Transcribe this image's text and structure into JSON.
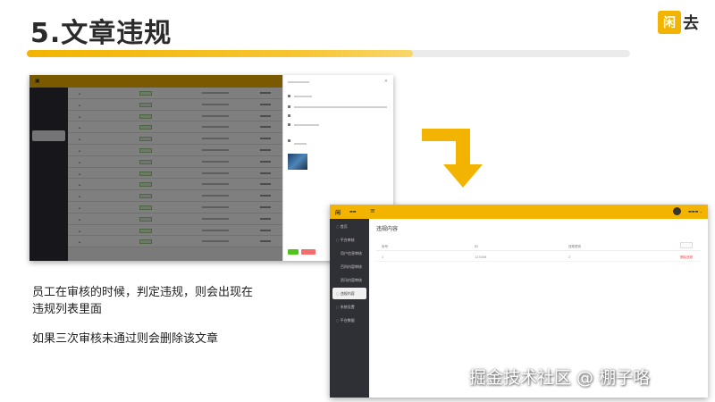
{
  "slide": {
    "title": "5.文章违规",
    "progress_fraction": 0.64
  },
  "logo": {
    "badge_char": "闲",
    "text": "去",
    "color": "#f2b400"
  },
  "caption": {
    "line1": "员工在审核的时候，判定违规，则会出现在",
    "line2": "违规列表里面",
    "line3": "如果三次审核未通过则会删除该文章"
  },
  "app": {
    "accent": "#f2b400",
    "sidebar_color": "#2f2f36",
    "title": "违规内容",
    "menu_icon": "hamburger-icon",
    "sidebar": [
      {
        "label": "首页",
        "icon": "home-icon"
      },
      {
        "label": "平台审核",
        "icon": "check-icon"
      },
      {
        "label": "用户信息审核",
        "icon": ""
      },
      {
        "label": "百科内容审核",
        "icon": ""
      },
      {
        "label": "资讯内容审核",
        "icon": ""
      },
      {
        "label": "违规内容",
        "icon": "warn-icon",
        "active": true
      },
      {
        "label": "系统设置",
        "icon": "gear-icon"
      },
      {
        "label": "平台数据",
        "icon": "chart-icon"
      }
    ],
    "table": {
      "columns": [
        "序号",
        "ID",
        "违规类别",
        "",
        "操作"
      ],
      "rows": [
        [
          "1",
          "123456",
          "2",
          "",
          "删除违规"
        ]
      ]
    }
  },
  "watermark": "掘金技术社区 @ 棚子咯"
}
